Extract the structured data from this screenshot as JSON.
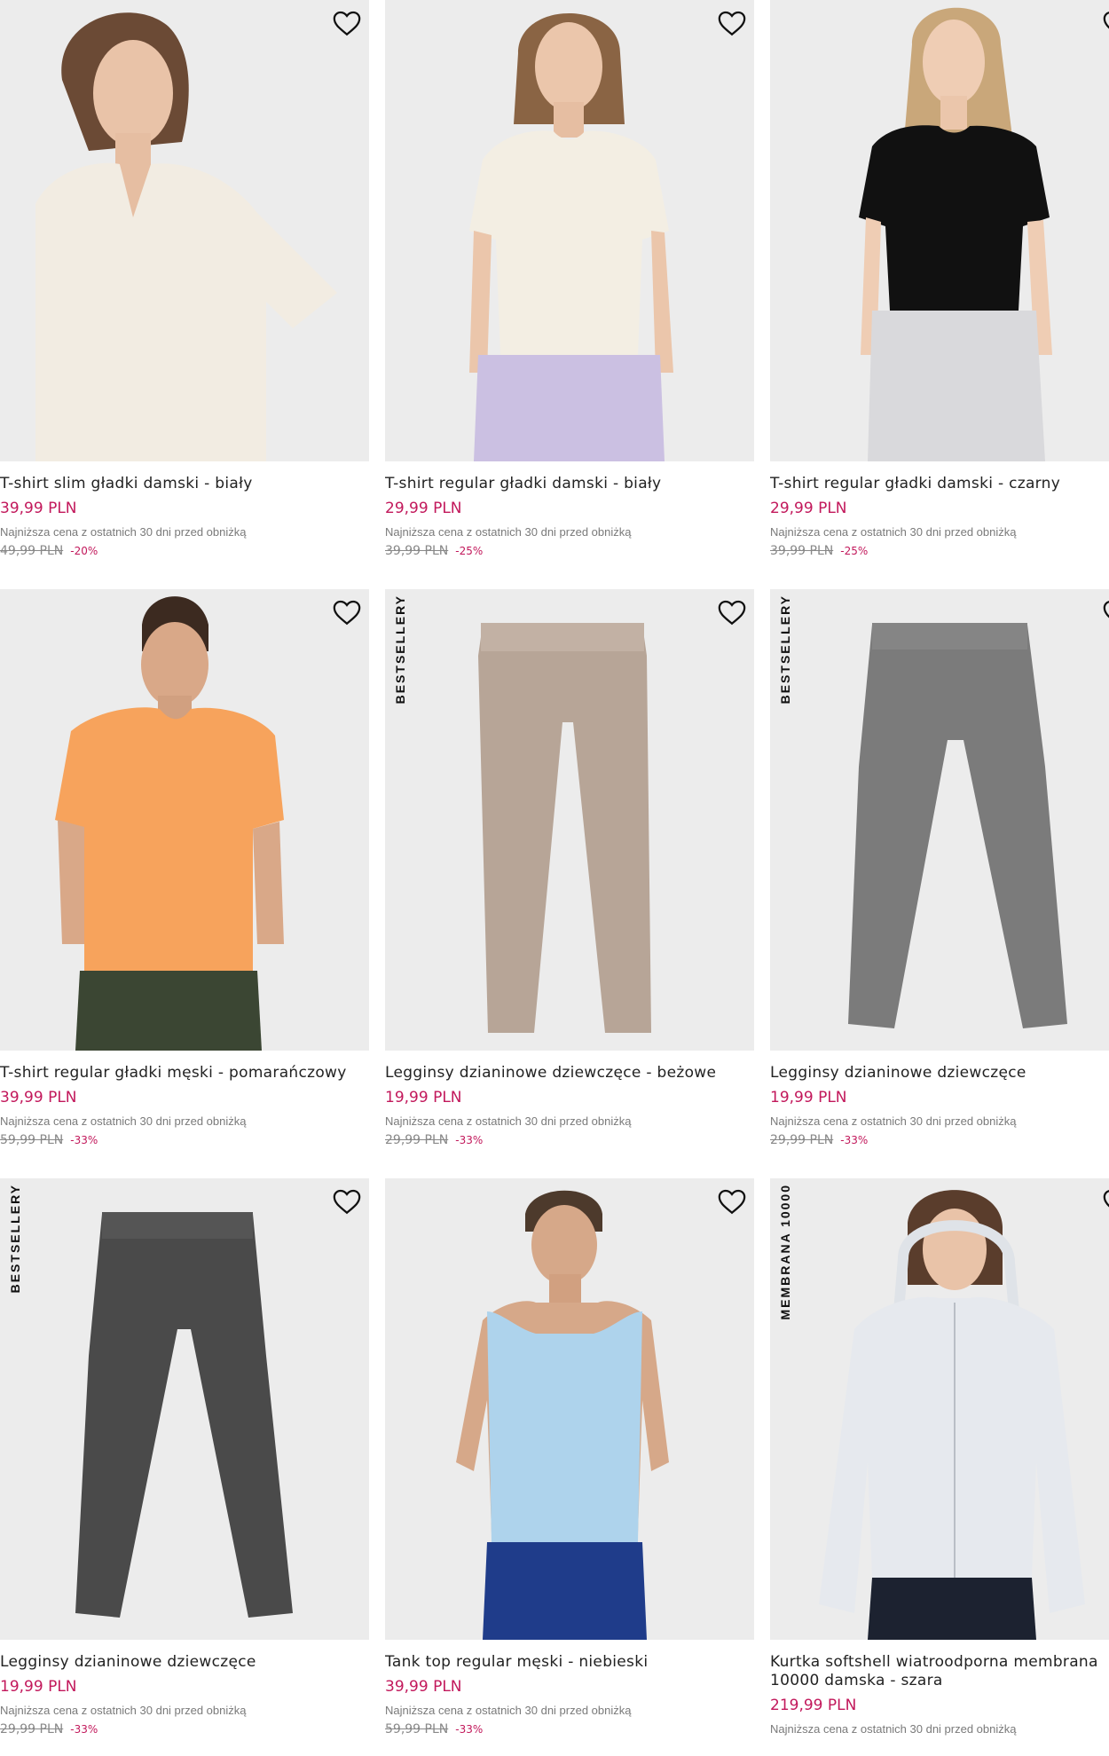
{
  "lowest_price_note": "Najniższa cena z ostatnich 30 dni przed obniżką",
  "products": [
    {
      "name": "T-shirt slim gładki damski - biały",
      "price": "39,99 PLN",
      "old_price": "49,99 PLN",
      "discount": "-20%",
      "badge": "",
      "favorite_icon": "heart-outline-icon"
    },
    {
      "name": "T-shirt regular gładki damski - biały",
      "price": "29,99 PLN",
      "old_price": "39,99 PLN",
      "discount": "-25%",
      "badge": "",
      "favorite_icon": "heart-outline-icon"
    },
    {
      "name": "T-shirt regular gładki damski - czarny",
      "price": "29,99 PLN",
      "old_price": "39,99 PLN",
      "discount": "-25%",
      "badge": "",
      "favorite_icon": "heart-outline-icon"
    },
    {
      "name": "T-shirt regular gładki męski - pomarańczowy",
      "price": "39,99 PLN",
      "old_price": "59,99 PLN",
      "discount": "-33%",
      "badge": "",
      "favorite_icon": "heart-outline-icon"
    },
    {
      "name": "Legginsy dzianinowe dziewczęce - beżowe",
      "price": "19,99 PLN",
      "old_price": "29,99 PLN",
      "discount": "-33%",
      "badge": "BESTSELLERY",
      "favorite_icon": "heart-outline-icon"
    },
    {
      "name": "Legginsy dzianinowe dziewczęce",
      "price": "19,99 PLN",
      "old_price": "29,99 PLN",
      "discount": "-33%",
      "badge": "BESTSELLERY",
      "favorite_icon": "heart-outline-icon"
    },
    {
      "name": "Legginsy dzianinowe dziewczęce",
      "price": "19,99 PLN",
      "old_price": "29,99 PLN",
      "discount": "-33%",
      "badge": "BESTSELLERY",
      "favorite_icon": "heart-outline-icon"
    },
    {
      "name": "Tank top regular męski - niebieski",
      "price": "39,99 PLN",
      "old_price": "59,99 PLN",
      "discount": "-33%",
      "badge": "",
      "favorite_icon": "heart-outline-icon"
    },
    {
      "name": "Kurtka softshell wiatroodporna membrana 10000 damska - szara",
      "price": "219,99 PLN",
      "old_price": "",
      "discount": "",
      "badge": "MEMBRANA 10000",
      "favorite_icon": "heart-outline-icon"
    }
  ],
  "colors": {
    "price": "#c2185b",
    "image_background": "#ececec",
    "text": "#222222",
    "muted": "#7a7a7a"
  }
}
